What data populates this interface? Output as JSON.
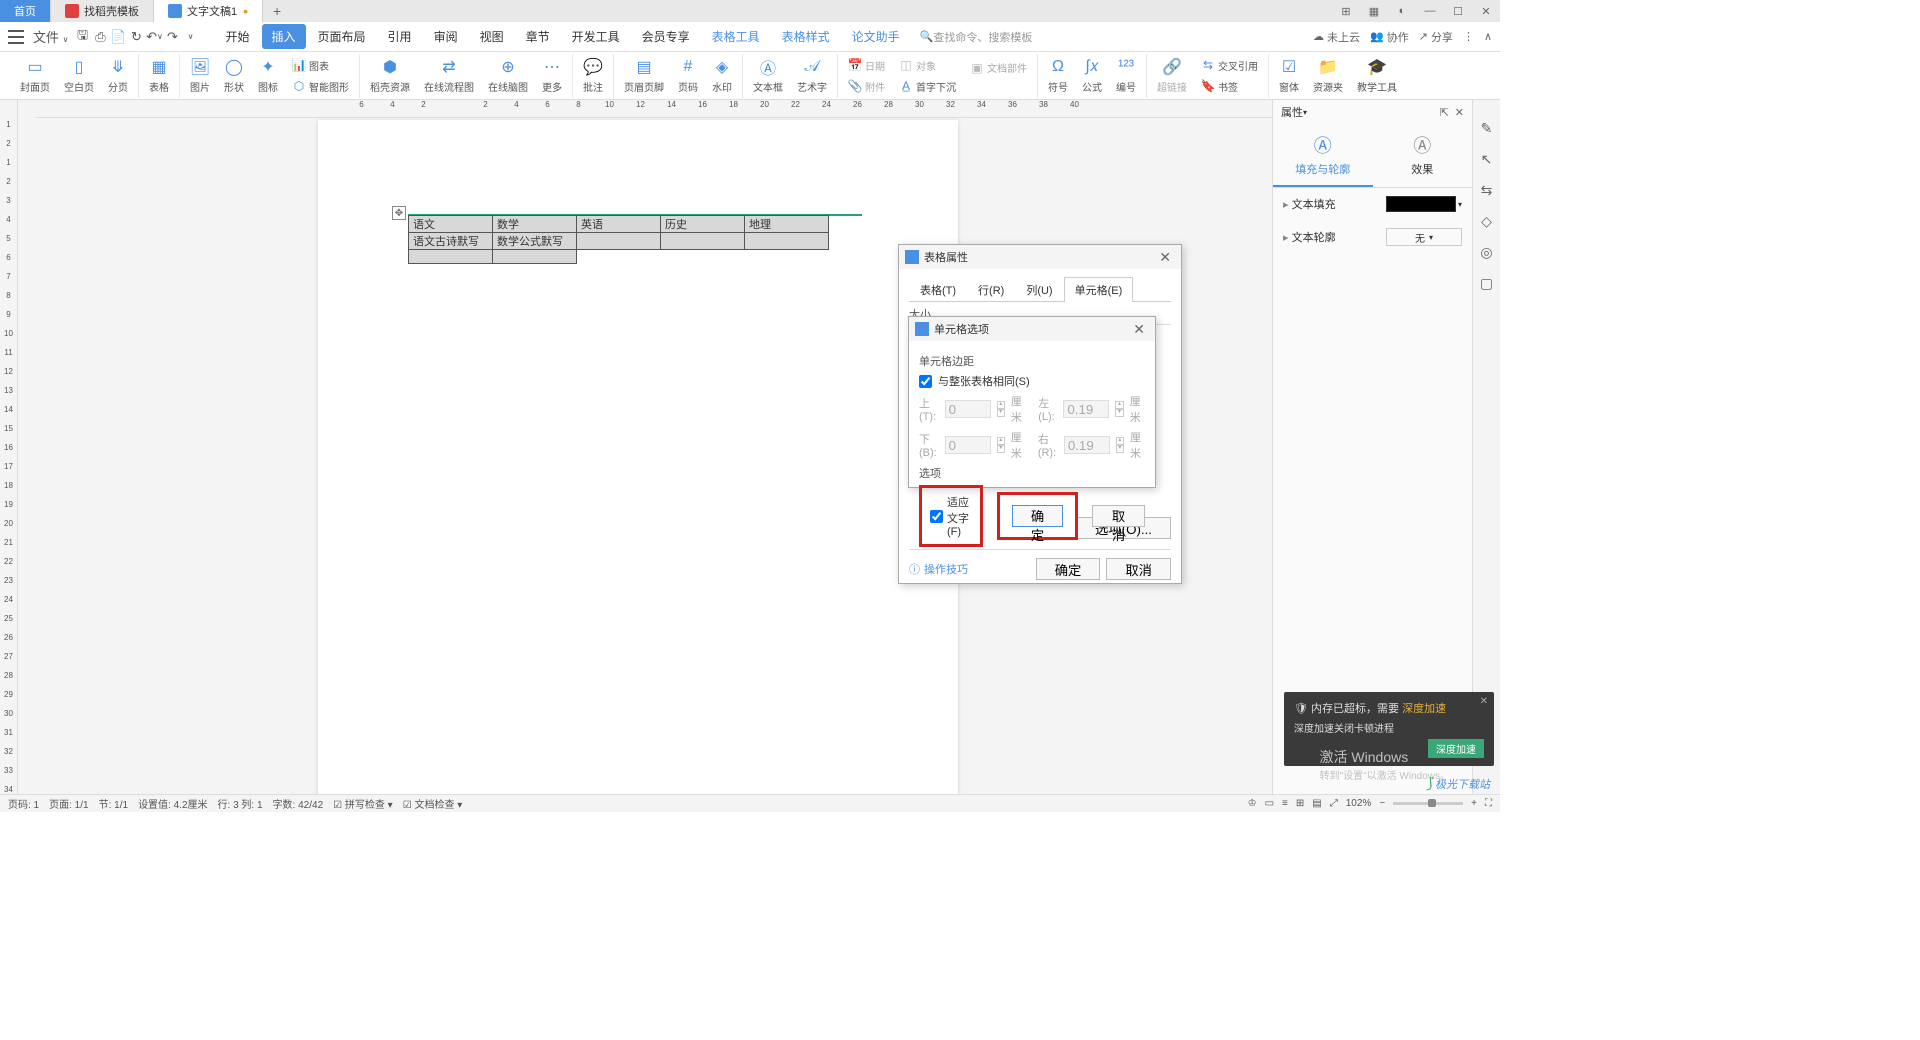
{
  "tabs": {
    "home": "首页",
    "template": "找稻壳模板",
    "doc": "文字文稿1"
  },
  "menubar": {
    "file": "文件",
    "tabs": [
      "开始",
      "插入",
      "页面布局",
      "引用",
      "审阅",
      "视图",
      "章节",
      "开发工具",
      "会员专享"
    ],
    "active_index": 1,
    "tool_tabs": [
      "表格工具",
      "表格样式",
      "论文助手"
    ],
    "search_placeholder": "查找命令、搜索模板"
  },
  "menu_right": {
    "cloud": "未上云",
    "collab": "协作",
    "share": "分享"
  },
  "ribbon": {
    "g1": [
      "封面页",
      "空白页",
      "分页"
    ],
    "g2": [
      "表格"
    ],
    "g3": [
      "图片",
      "形状",
      "图标"
    ],
    "g4_top": "图表",
    "g4_bottom": "智能图形",
    "g5_a": "稻壳资源",
    "g5_b": "在线流程图",
    "g5_c": "在线脑图",
    "g5_d": "更多",
    "g6": [
      "批注"
    ],
    "g7": [
      "页眉页脚",
      "页码",
      "水印"
    ],
    "g8": [
      "文本框",
      "艺术字"
    ],
    "g9": [
      "日期",
      "附件"
    ],
    "g9b": [
      "对象",
      "首字下沉",
      "文档部件"
    ],
    "g10": [
      "符号",
      "公式",
      "编号"
    ],
    "g11": [
      "超链接"
    ],
    "g11b": [
      "交叉引用",
      "书签"
    ],
    "g12": [
      "窗体",
      "资源夹",
      "教学工具"
    ]
  },
  "table": {
    "r1": [
      "语文",
      "数学",
      "英语",
      "历史",
      "地理"
    ],
    "r2": [
      "语文古诗默写",
      "数学公式默写",
      "",
      "",
      ""
    ]
  },
  "dlg_props": {
    "title": "表格属性",
    "tabs": [
      "表格(T)",
      "行(R)",
      "列(U)",
      "单元格(E)"
    ],
    "size_label": "大小",
    "options_btn": "选项(O)...",
    "tips": "操作技巧",
    "ok": "确定",
    "cancel": "取消"
  },
  "dlg_cell": {
    "title": "单元格选项",
    "margins_label": "单元格边距",
    "same_as_table": "与整张表格相同(S)",
    "top": "上(T):",
    "bottom": "下(B):",
    "left": "左(L):",
    "right": "右(R):",
    "top_v": "0",
    "bottom_v": "0",
    "left_v": "0.19",
    "right_v": "0.19",
    "unit": "厘米",
    "opts_label": "选项",
    "fit_text": "适应文字(F)",
    "ok": "确定",
    "cancel": "取消"
  },
  "right_panel": {
    "title": "属性",
    "tab1": "填充与轮廓",
    "tab2": "效果",
    "row1": "文本填充",
    "row2": "文本轮廓",
    "outline_val": "无"
  },
  "status": {
    "pageno": "页码: 1",
    "page": "页面: 1/1",
    "section": "节: 1/1",
    "setval": "设置值: 4.2厘米",
    "rowcol": "行: 3  列: 1",
    "chars": "字数: 42/42",
    "spell": "拼写检查",
    "doccheck": "文档检查",
    "zoom": "102%"
  },
  "toast": {
    "title_a": "内存已超标，需要",
    "title_b": "深度加速",
    "sub": "深度加速关闭卡顿进程",
    "btn": "深度加速"
  },
  "activate": {
    "title": "激活 Windows",
    "sub": "转到\"设置\"以激活 Windows。"
  },
  "watermark": "极光下载站"
}
